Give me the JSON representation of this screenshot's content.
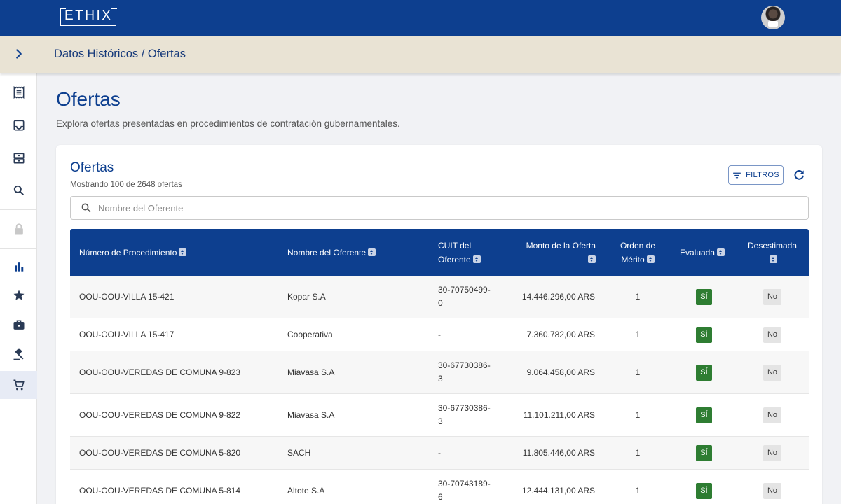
{
  "app": {
    "logo": "ETHIX"
  },
  "breadcrumb": "Datos Históricos / Ofertas",
  "page": {
    "title": "Ofertas",
    "subtitle": "Explora ofertas presentadas en procedimientos de contratación gubernamentales."
  },
  "card": {
    "title": "Ofertas",
    "count": "Mostrando 100 de 2648 ofertas",
    "filter_label": "FILTROS",
    "search_placeholder": "Nombre del Oferente"
  },
  "sidebar": {
    "icons": [
      "receipt-icon",
      "inbox-icon",
      "archive-icon",
      "search-icon",
      "lock-icon",
      "bar-chart-icon",
      "star-icon",
      "briefcase-icon",
      "gavel-icon",
      "cart-icon"
    ],
    "active": "cart-icon"
  },
  "table": {
    "columns": [
      {
        "line1": "Número de Procedimiento",
        "line2": ""
      },
      {
        "line1": "Nombre del Oferente",
        "line2": ""
      },
      {
        "line1": "CUIT del",
        "line2": "Oferente"
      },
      {
        "line1": "Monto de la Oferta",
        "line2": ""
      },
      {
        "line1": "Orden de",
        "line2": "Mérito"
      },
      {
        "line1": "Evaluada",
        "line2": ""
      },
      {
        "line1": "Desestimada",
        "line2": ""
      }
    ],
    "rows": [
      {
        "procedimiento": "OOU-OOU-VILLA 15-421",
        "oferente": "Kopar S.A",
        "cuit1": "30-70750499-",
        "cuit2": "0",
        "monto": "14.446.296,00 ARS",
        "orden": "1",
        "evaluada": "SÍ",
        "desestimada": "No"
      },
      {
        "procedimiento": "OOU-OOU-VILLA 15-417",
        "oferente": "Cooperativa",
        "cuit1": "-",
        "cuit2": "",
        "monto": "7.360.782,00 ARS",
        "orden": "1",
        "evaluada": "SÍ",
        "desestimada": "No"
      },
      {
        "procedimiento": "OOU-OOU-VEREDAS DE COMUNA 9-823",
        "oferente": "Miavasa S.A",
        "cuit1": "30-67730386-",
        "cuit2": "3",
        "monto": "9.064.458,00 ARS",
        "orden": "1",
        "evaluada": "SÍ",
        "desestimada": "No"
      },
      {
        "procedimiento": "OOU-OOU-VEREDAS DE COMUNA 9-822",
        "oferente": "Miavasa S.A",
        "cuit1": "30-67730386-",
        "cuit2": "3",
        "monto": "11.101.211,00 ARS",
        "orden": "1",
        "evaluada": "SÍ",
        "desestimada": "No"
      },
      {
        "procedimiento": "OOU-OOU-VEREDAS DE COMUNA 5-820",
        "oferente": "SACH",
        "cuit1": "-",
        "cuit2": "",
        "monto": "11.805.446,00 ARS",
        "orden": "1",
        "evaluada": "SÍ",
        "desestimada": "No"
      },
      {
        "procedimiento": "OOU-OOU-VEREDAS DE COMUNA 5-814",
        "oferente": "Altote S.A",
        "cuit1": "30-70743189-",
        "cuit2": "6",
        "monto": "12.444.131,00 ARS",
        "orden": "1",
        "evaluada": "SÍ",
        "desestimada": "No"
      }
    ]
  }
}
